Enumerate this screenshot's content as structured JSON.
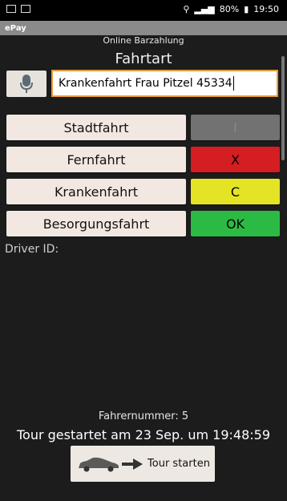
{
  "status_bar": {
    "battery": "80%",
    "time": "19:50"
  },
  "app": {
    "title": "ePay"
  },
  "screen": {
    "subtitle": "Online Barzahlung",
    "heading": "Fahrtart"
  },
  "input": {
    "value": "Krankenfahrt Frau Pitzel 45334"
  },
  "trip_buttons": {
    "stadtfahrt": "Stadtfahrt",
    "fernfahrt": "Fernfahrt",
    "krankenfahrt": "Krankenfahrt",
    "besorgungsfahrt": "Besorgungsfahrt"
  },
  "control_buttons": {
    "i": "I",
    "x": "X",
    "c": "C",
    "ok": "OK"
  },
  "driver": {
    "label": "Driver ID:"
  },
  "info": {
    "fahrernummer": "Fahrernummer: 5",
    "tour": "Tour gestartet am 23 Sep. um 19:48:59"
  },
  "start": {
    "label": "Tour starten"
  },
  "colors": {
    "accent_orange": "#e79a3f",
    "red": "#d41e22",
    "yellow": "#e4e425",
    "green": "#2bbb44"
  }
}
